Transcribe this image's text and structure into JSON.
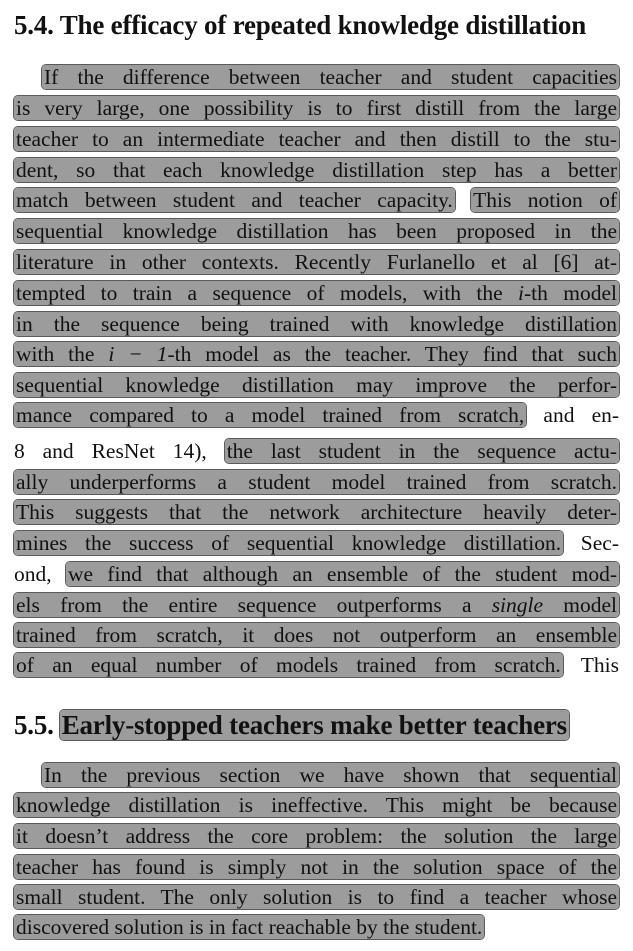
{
  "section_54": {
    "number": "5.4.",
    "title": "The efficacy of repeated knowledge distillation",
    "lines": [
      "If the difference between teacher and student capacities",
      "is very large, one possibility is to first distill from the large",
      "teacher to an intermediate teacher and then distill to the stu-",
      "dent, so that each knowledge distillation step has a better",
      "match between student and teacher capacity.",
      "This notion of",
      "sequential knowledge distillation has been proposed in the",
      "literature in other contexts. Recently Furlanello et al [6] at-",
      "tempted to train a sequence of models, with the",
      "i",
      "-th model",
      "in the sequence being trained with knowledge distillation",
      "with the",
      "i − 1",
      "-th model as the teacher. They find that such",
      "sequential knowledge distillation may improve the perfor-",
      "mance compared to a model trained from scratch,",
      "and en-",
      "8 and ResNet 14),",
      "the last student in the sequence actu-",
      "ally underperforms a student model trained from scratch.",
      "This suggests that the network architecture heavily deter-",
      "mines the success of sequential knowledge distillation.",
      "Sec-",
      "ond,",
      "we find that although an ensemble of the student mod-",
      "els from the entire sequence outperforms a",
      "single",
      "model",
      "trained from scratch, it does not outperform an ensemble",
      "of an equal number of models trained from scratch.",
      "This"
    ]
  },
  "section_55": {
    "number": "5.5.",
    "title": "Early-stopped teachers make better teachers",
    "lines": [
      "In the previous section we have shown that sequential",
      "knowledge distillation is ineffective. This might be because",
      "it doesn’t address the core problem: the solution the large",
      "teacher has found is simply not in the solution space of the",
      "small student. The only solution is to find a teacher whose",
      "discovered solution is in fact reachable by the student."
    ]
  }
}
